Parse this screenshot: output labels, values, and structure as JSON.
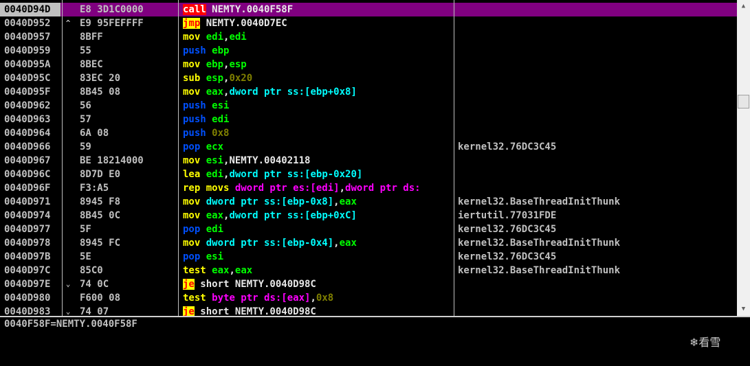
{
  "rows": [
    {
      "addr": "0040D94D",
      "jm": "",
      "hex": "E8 3D1C0000",
      "asm": [
        [
          "call",
          "call"
        ],
        [
          "wht",
          " NEMTY.0040F58F"
        ]
      ],
      "comment": "",
      "selected": true
    },
    {
      "addr": "0040D952",
      "jm": "^",
      "hex": "E9 95FEFFFF",
      "asm": [
        [
          "jmp",
          "jmp"
        ],
        [
          "wht",
          " NEMTY.0040D7EC"
        ]
      ],
      "comment": ""
    },
    {
      "addr": "0040D957",
      "jm": "",
      "hex": "8BFF",
      "asm": [
        [
          "yel",
          "mov "
        ],
        [
          "grn",
          "edi"
        ],
        [
          "wht",
          ","
        ],
        [
          "grn",
          "edi"
        ]
      ],
      "comment": ""
    },
    {
      "addr": "0040D959",
      "jm": "",
      "hex": "55",
      "asm": [
        [
          "blue",
          "push "
        ],
        [
          "grn",
          "ebp"
        ]
      ],
      "comment": ""
    },
    {
      "addr": "0040D95A",
      "jm": "",
      "hex": "8BEC",
      "asm": [
        [
          "yel",
          "mov "
        ],
        [
          "grn",
          "ebp"
        ],
        [
          "wht",
          ","
        ],
        [
          "grn",
          "esp"
        ]
      ],
      "comment": ""
    },
    {
      "addr": "0040D95C",
      "jm": "",
      "hex": "83EC 20",
      "asm": [
        [
          "yel",
          "sub "
        ],
        [
          "grn",
          "esp"
        ],
        [
          "wht",
          ","
        ],
        [
          "olive",
          "0x20"
        ]
      ],
      "comment": ""
    },
    {
      "addr": "0040D95F",
      "jm": "",
      "hex": "8B45 08",
      "asm": [
        [
          "yel",
          "mov "
        ],
        [
          "grn",
          "eax"
        ],
        [
          "wht",
          ","
        ],
        [
          "cyan",
          "dword ptr ss:[ebp+0x8]"
        ]
      ],
      "comment": ""
    },
    {
      "addr": "0040D962",
      "jm": "",
      "hex": "56",
      "asm": [
        [
          "blue",
          "push "
        ],
        [
          "grn",
          "esi"
        ]
      ],
      "comment": ""
    },
    {
      "addr": "0040D963",
      "jm": "",
      "hex": "57",
      "asm": [
        [
          "blue",
          "push "
        ],
        [
          "grn",
          "edi"
        ]
      ],
      "comment": ""
    },
    {
      "addr": "0040D964",
      "jm": "",
      "hex": "6A 08",
      "asm": [
        [
          "blue",
          "push "
        ],
        [
          "olive",
          "0x8"
        ]
      ],
      "comment": ""
    },
    {
      "addr": "0040D966",
      "jm": "",
      "hex": "59",
      "asm": [
        [
          "blue",
          "pop "
        ],
        [
          "grn",
          "ecx"
        ]
      ],
      "comment": "kernel32.76DC3C45"
    },
    {
      "addr": "0040D967",
      "jm": "",
      "hex": "BE 18214000",
      "asm": [
        [
          "yel",
          "mov "
        ],
        [
          "grn",
          "esi"
        ],
        [
          "wht",
          ",NEMTY.00402118"
        ]
      ],
      "comment": ""
    },
    {
      "addr": "0040D96C",
      "jm": "",
      "hex": "8D7D E0",
      "asm": [
        [
          "yel",
          "lea "
        ],
        [
          "grn",
          "edi"
        ],
        [
          "wht",
          ","
        ],
        [
          "cyan",
          "dword ptr ss:[ebp-0x20]"
        ]
      ],
      "comment": ""
    },
    {
      "addr": "0040D96F",
      "jm": "",
      "hex": "F3:A5",
      "asm": [
        [
          "yel",
          "rep movs "
        ],
        [
          "mag",
          "dword ptr es:[edi]"
        ],
        [
          "wht",
          ","
        ],
        [
          "mag",
          "dword ptr ds:"
        ]
      ],
      "comment": ""
    },
    {
      "addr": "0040D971",
      "jm": "",
      "hex": "8945 F8",
      "asm": [
        [
          "yel",
          "mov "
        ],
        [
          "cyan",
          "dword ptr ss:[ebp-0x8]"
        ],
        [
          "wht",
          ","
        ],
        [
          "grn",
          "eax"
        ]
      ],
      "comment": "kernel32.BaseThreadInitThunk"
    },
    {
      "addr": "0040D974",
      "jm": "",
      "hex": "8B45 0C",
      "asm": [
        [
          "yel",
          "mov "
        ],
        [
          "grn",
          "eax"
        ],
        [
          "wht",
          ","
        ],
        [
          "cyan",
          "dword ptr ss:[ebp+0xC]"
        ]
      ],
      "comment": "iertutil.77031FDE"
    },
    {
      "addr": "0040D977",
      "jm": "",
      "hex": "5F",
      "asm": [
        [
          "blue",
          "pop "
        ],
        [
          "grn",
          "edi"
        ]
      ],
      "comment": "kernel32.76DC3C45"
    },
    {
      "addr": "0040D978",
      "jm": "",
      "hex": "8945 FC",
      "asm": [
        [
          "yel",
          "mov "
        ],
        [
          "cyan",
          "dword ptr ss:[ebp-0x4]"
        ],
        [
          "wht",
          ","
        ],
        [
          "grn",
          "eax"
        ]
      ],
      "comment": "kernel32.BaseThreadInitThunk"
    },
    {
      "addr": "0040D97B",
      "jm": "",
      "hex": "5E",
      "asm": [
        [
          "blue",
          "pop "
        ],
        [
          "grn",
          "esi"
        ]
      ],
      "comment": "kernel32.76DC3C45"
    },
    {
      "addr": "0040D97C",
      "jm": "",
      "hex": "85C0",
      "asm": [
        [
          "yel",
          "test "
        ],
        [
          "grn",
          "eax"
        ],
        [
          "wht",
          ","
        ],
        [
          "grn",
          "eax"
        ]
      ],
      "comment": "kernel32.BaseThreadInitThunk"
    },
    {
      "addr": "0040D97E",
      "jm": "⌄",
      "hex": "74 0C",
      "asm": [
        [
          "jmp",
          "je"
        ],
        [
          "wht",
          " short NEMTY.0040D98C"
        ]
      ],
      "comment": ""
    },
    {
      "addr": "0040D980",
      "jm": "",
      "hex": "F600 08",
      "asm": [
        [
          "yel",
          "test "
        ],
        [
          "mag",
          "byte ptr ds:[eax]"
        ],
        [
          "wht",
          ","
        ],
        [
          "olive",
          "0x8"
        ]
      ],
      "comment": ""
    },
    {
      "addr": "0040D983",
      "jm": "⌄",
      "hex": "74 07",
      "asm": [
        [
          "jmp",
          "je"
        ],
        [
          "wht",
          " short NEMTY.0040D98C"
        ]
      ],
      "comment": ""
    }
  ],
  "info_pane": {
    "text": "0040F58F=NEMTY.0040F58F"
  },
  "watermark": {
    "text": "❄看雪"
  },
  "colors": {
    "selected_row": "#800080",
    "call_bg": "#ff0000",
    "jmp_bg": "#ffff00",
    "mnemonic": "#ffff00",
    "stack_op": "#0050ff",
    "register": "#00ff00",
    "memory": "#00ffff",
    "constant": "#808000",
    "string_mem": "#ff00ff"
  }
}
